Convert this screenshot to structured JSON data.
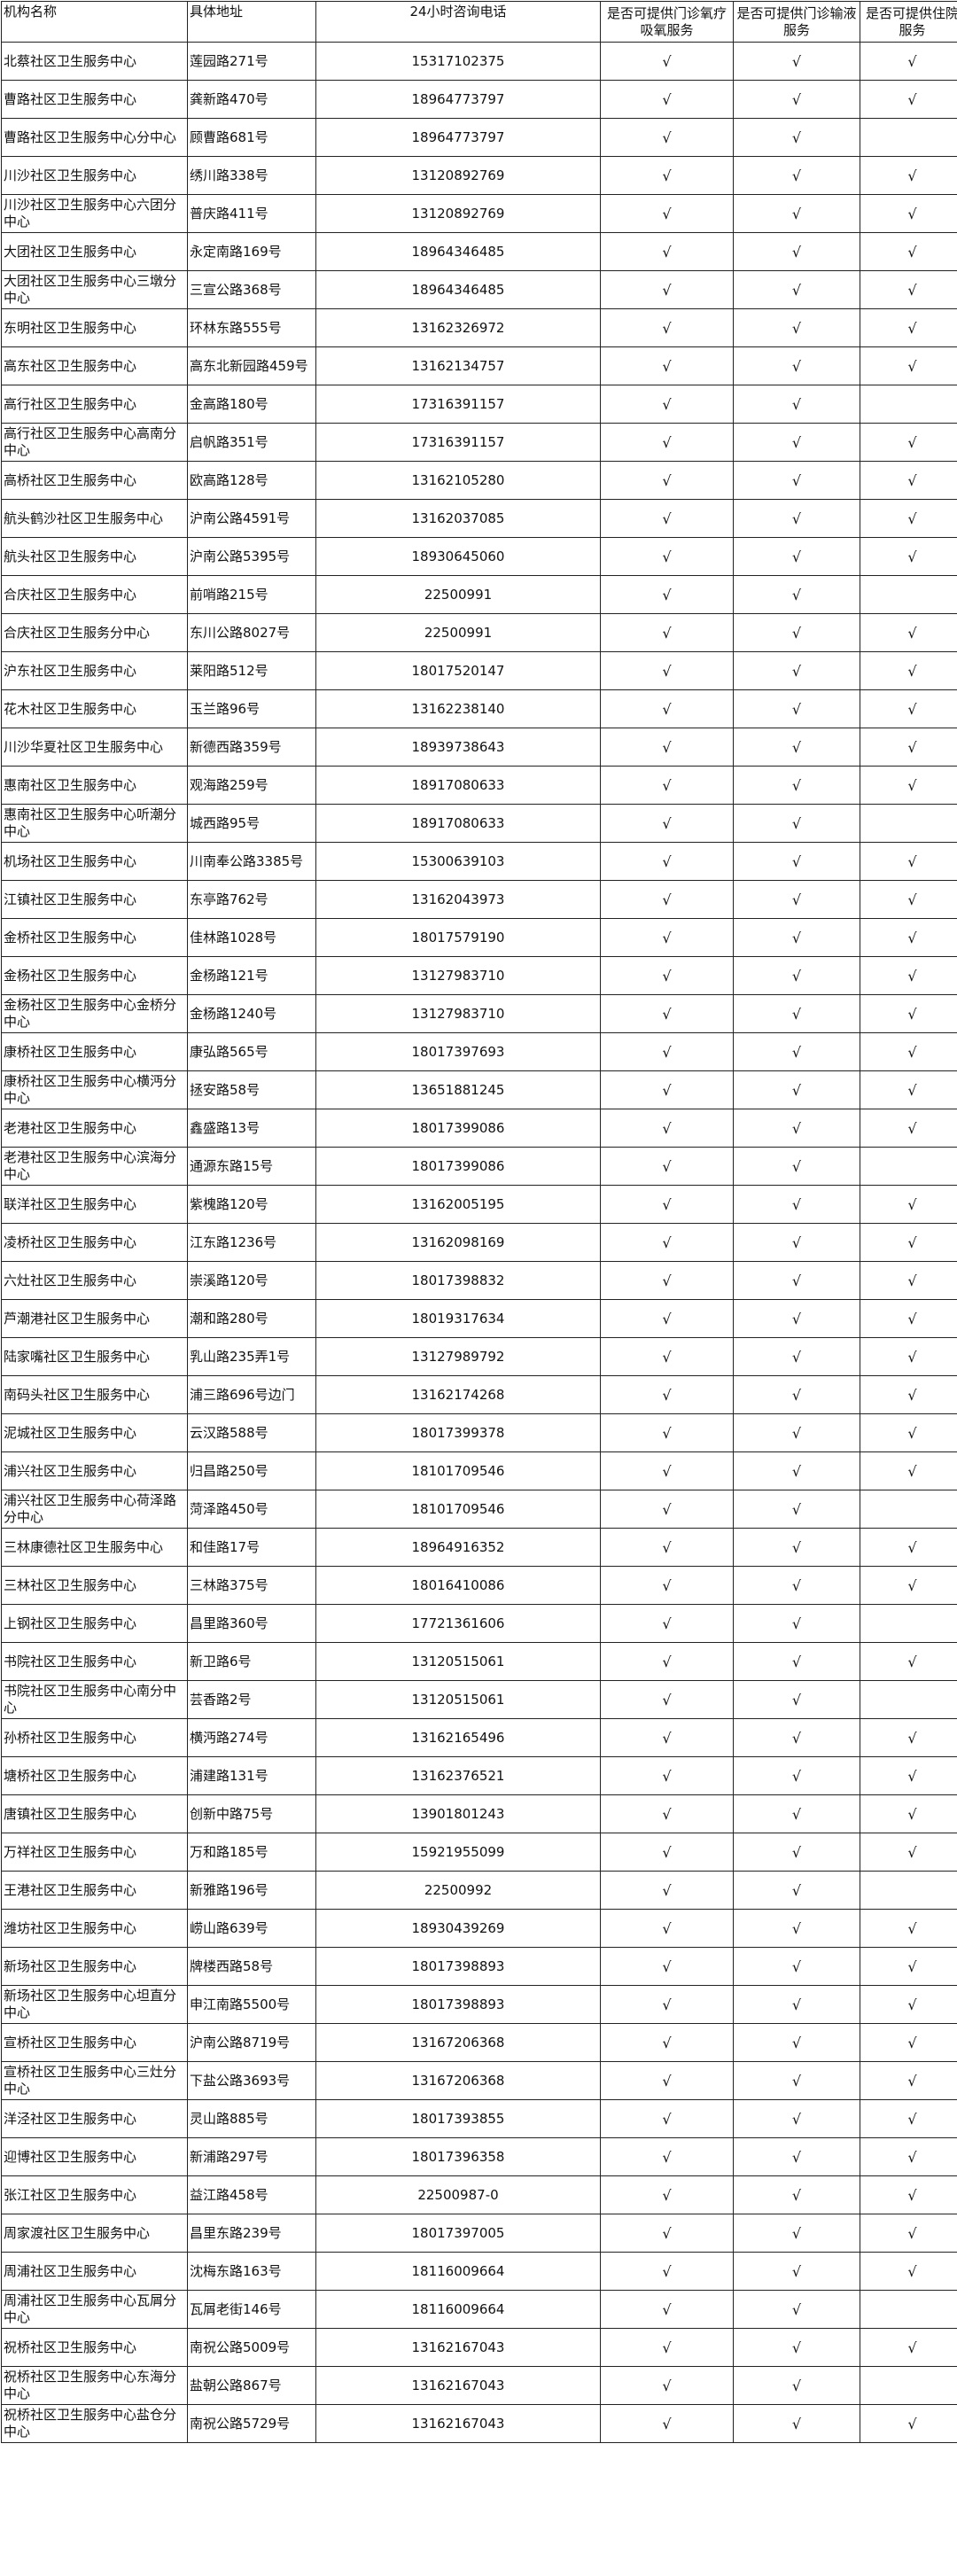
{
  "headers": [
    "机构名称",
    "具体地址",
    "24小时咨询电话",
    "是否可提供门诊氧疗吸氧服务",
    "是否可提供门诊输液服务",
    "是否可提供住院服务"
  ],
  "rows": [
    [
      "北蔡社区卫生服务中心",
      "莲园路271号",
      "15317102375",
      "√",
      "√",
      "√"
    ],
    [
      "曹路社区卫生服务中心",
      "龚新路470号",
      "18964773797",
      "√",
      "√",
      "√"
    ],
    [
      "曹路社区卫生服务中心分中心",
      "顾曹路681号",
      "18964773797",
      "√",
      "√",
      ""
    ],
    [
      "川沙社区卫生服务中心",
      "绣川路338号",
      "13120892769",
      "√",
      "√",
      "√"
    ],
    [
      "川沙社区卫生服务中心六团分中心",
      "普庆路411号",
      "13120892769",
      "√",
      "√",
      "√"
    ],
    [
      "大团社区卫生服务中心",
      "永定南路169号",
      "18964346485",
      "√",
      "√",
      "√"
    ],
    [
      "大团社区卫生服务中心三墩分中心",
      "三宣公路368号",
      "18964346485",
      "√",
      "√",
      "√"
    ],
    [
      "东明社区卫生服务中心",
      "环林东路555号",
      "13162326972",
      "√",
      "√",
      "√"
    ],
    [
      "高东社区卫生服务中心",
      "高东北新园路459号",
      "13162134757",
      "√",
      "√",
      "√"
    ],
    [
      "高行社区卫生服务中心",
      "金高路180号",
      "17316391157",
      "√",
      "√",
      ""
    ],
    [
      "高行社区卫生服务中心高南分中心",
      "启帆路351号",
      "17316391157",
      "√",
      "√",
      "√"
    ],
    [
      "高桥社区卫生服务中心",
      "欧高路128号",
      "13162105280",
      "√",
      "√",
      "√"
    ],
    [
      "航头鹤沙社区卫生服务中心",
      "沪南公路4591号",
      "13162037085",
      "√",
      "√",
      "√"
    ],
    [
      "航头社区卫生服务中心",
      "沪南公路5395号",
      "18930645060",
      "√",
      "√",
      "√"
    ],
    [
      "合庆社区卫生服务中心",
      "前哨路215号",
      "22500991",
      "√",
      "√",
      ""
    ],
    [
      "合庆社区卫生服务分中心",
      "东川公路8027号",
      "22500991",
      "√",
      "√",
      "√"
    ],
    [
      "沪东社区卫生服务中心",
      "莱阳路512号",
      "18017520147",
      "√",
      "√",
      "√"
    ],
    [
      "花木社区卫生服务中心",
      "玉兰路96号",
      "13162238140",
      "√",
      "√",
      "√"
    ],
    [
      "川沙华夏社区卫生服务中心",
      "新德西路359号",
      "18939738643",
      "√",
      "√",
      "√"
    ],
    [
      "惠南社区卫生服务中心",
      "观海路259号",
      "18917080633",
      "√",
      "√",
      "√"
    ],
    [
      "惠南社区卫生服务中心听潮分中心",
      "城西路95号",
      "18917080633",
      "√",
      "√",
      ""
    ],
    [
      "机场社区卫生服务中心",
      "川南奉公路3385号",
      "15300639103",
      "√",
      "√",
      "√"
    ],
    [
      "江镇社区卫生服务中心",
      "东亭路762号",
      "13162043973",
      "√",
      "√",
      "√"
    ],
    [
      "金桥社区卫生服务中心",
      "佳林路1028号",
      "18017579190",
      "√",
      "√",
      "√"
    ],
    [
      "金杨社区卫生服务中心",
      "金杨路121号",
      "13127983710",
      "√",
      "√",
      "√"
    ],
    [
      "金杨社区卫生服务中心金桥分中心",
      "金杨路1240号",
      "13127983710",
      "√",
      "√",
      "√"
    ],
    [
      "康桥社区卫生服务中心",
      "康弘路565号",
      "18017397693",
      "√",
      "√",
      "√"
    ],
    [
      "康桥社区卫生服务中心横沔分中心",
      "拯安路58号",
      "13651881245",
      "√",
      "√",
      "√"
    ],
    [
      "老港社区卫生服务中心",
      "鑫盛路13号",
      "18017399086",
      "√",
      "√",
      "√"
    ],
    [
      "老港社区卫生服务中心滨海分中心",
      "通源东路15号",
      "18017399086",
      "√",
      "√",
      ""
    ],
    [
      "联洋社区卫生服务中心",
      "紫槐路120号",
      "13162005195",
      "√",
      "√",
      "√"
    ],
    [
      "凌桥社区卫生服务中心",
      "江东路1236号",
      "13162098169",
      "√",
      "√",
      "√"
    ],
    [
      "六灶社区卫生服务中心",
      "崇溪路120号",
      "18017398832",
      "√",
      "√",
      "√"
    ],
    [
      "芦潮港社区卫生服务中心",
      "潮和路280号",
      "18019317634",
      "√",
      "√",
      "√"
    ],
    [
      "陆家嘴社区卫生服务中心",
      "乳山路235弄1号",
      "13127989792",
      "√",
      "√",
      "√"
    ],
    [
      "南码头社区卫生服务中心",
      "浦三路696号边门",
      "13162174268",
      "√",
      "√",
      "√"
    ],
    [
      "泥城社区卫生服务中心",
      "云汉路588号",
      "18017399378",
      "√",
      "√",
      "√"
    ],
    [
      "浦兴社区卫生服务中心",
      "归昌路250号",
      "18101709546",
      "√",
      "√",
      "√"
    ],
    [
      "浦兴社区卫生服务中心荷泽路分中心",
      "菏泽路450号",
      "18101709546",
      "√",
      "√",
      ""
    ],
    [
      "三林康德社区卫生服务中心",
      "和佳路17号",
      "18964916352",
      "√",
      "√",
      "√"
    ],
    [
      "三林社区卫生服务中心",
      "三林路375号",
      "18016410086",
      "√",
      "√",
      "√"
    ],
    [
      "上钢社区卫生服务中心",
      "昌里路360号",
      "17721361606",
      "√",
      "√",
      ""
    ],
    [
      "书院社区卫生服务中心",
      "新卫路6号",
      "13120515061",
      "√",
      "√",
      "√"
    ],
    [
      "书院社区卫生服务中心南分中心",
      "芸香路2号",
      "13120515061",
      "√",
      "√",
      ""
    ],
    [
      "孙桥社区卫生服务中心",
      "横沔路274号",
      "13162165496",
      "√",
      "√",
      "√"
    ],
    [
      "塘桥社区卫生服务中心",
      "浦建路131号",
      "13162376521",
      "√",
      "√",
      "√"
    ],
    [
      "唐镇社区卫生服务中心",
      "创新中路75号",
      "13901801243",
      "√",
      "√",
      "√"
    ],
    [
      "万祥社区卫生服务中心",
      "万和路185号",
      "15921955099",
      "√",
      "√",
      "√"
    ],
    [
      "王港社区卫生服务中心",
      "新雅路196号",
      "22500992",
      "√",
      "√",
      ""
    ],
    [
      "潍坊社区卫生服务中心",
      "崂山路639号",
      "18930439269",
      "√",
      "√",
      "√"
    ],
    [
      "新场社区卫生服务中心",
      "牌楼西路58号",
      "18017398893",
      "√",
      "√",
      "√"
    ],
    [
      "新场社区卫生服务中心坦直分中心",
      "申江南路5500号",
      "18017398893",
      "√",
      "√",
      "√"
    ],
    [
      "宣桥社区卫生服务中心",
      "沪南公路8719号",
      "13167206368",
      "√",
      "√",
      "√"
    ],
    [
      "宣桥社区卫生服务中心三灶分中心",
      "下盐公路3693号",
      "13167206368",
      "√",
      "√",
      "√"
    ],
    [
      "洋泾社区卫生服务中心",
      "灵山路885号",
      "18017393855",
      "√",
      "√",
      "√"
    ],
    [
      "迎博社区卫生服务中心",
      "新浦路297号",
      "18017396358",
      "√",
      "√",
      "√"
    ],
    [
      "张江社区卫生服务中心",
      "益江路458号",
      "22500987-0",
      "√",
      "√",
      "√"
    ],
    [
      "周家渡社区卫生服务中心",
      "昌里东路239号",
      "18017397005",
      "√",
      "√",
      "√"
    ],
    [
      "周浦社区卫生服务中心",
      "沈梅东路163号",
      "18116009664",
      "√",
      "√",
      "√"
    ],
    [
      "周浦社区卫生服务中心瓦屑分中心",
      "瓦屑老街146号",
      "18116009664",
      "√",
      "√",
      ""
    ],
    [
      "祝桥社区卫生服务中心",
      "南祝公路5009号",
      "13162167043",
      "√",
      "√",
      "√"
    ],
    [
      "祝桥社区卫生服务中心东海分中心",
      "盐朝公路867号",
      "13162167043",
      "√",
      "√",
      ""
    ],
    [
      "祝桥社区卫生服务中心盐仓分中心",
      "南祝公路5729号",
      "13162167043",
      "√",
      "√",
      "√"
    ]
  ]
}
